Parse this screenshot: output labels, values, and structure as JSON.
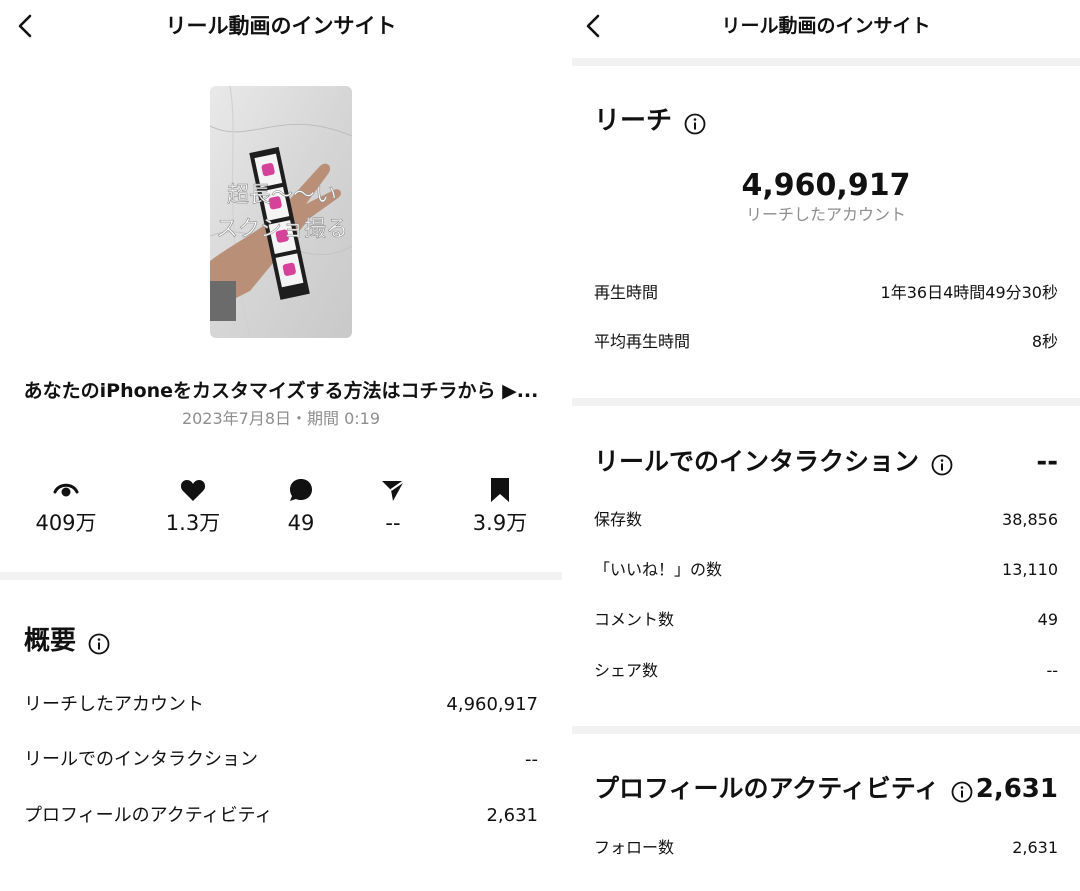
{
  "left": {
    "title": "リール動画のインサイト",
    "thumbnail": {
      "overlay_line1": "超長〜〜い",
      "overlay_line2": "スクショ撮る"
    },
    "caption": "あなたのiPhoneをカスタマイズする方法はコチラから ▶...",
    "date": "2023年7月8日・期間 0:19",
    "stats": [
      {
        "icon": "eye-icon",
        "value": "409万"
      },
      {
        "icon": "heart-icon",
        "value": "1.3万"
      },
      {
        "icon": "comment-icon",
        "value": "49"
      },
      {
        "icon": "share-icon",
        "value": "--"
      },
      {
        "icon": "bookmark-icon",
        "value": "3.9万"
      }
    ],
    "overview": {
      "title": "概要",
      "rows": [
        {
          "label": "リーチしたアカウント",
          "value": "4,960,917"
        },
        {
          "label": "リールでのインタラクション",
          "value": "--"
        },
        {
          "label": "プロフィールのアクティビティ",
          "value": "2,631"
        }
      ]
    }
  },
  "right": {
    "title": "リール動画のインサイト",
    "reach": {
      "title": "リーチ",
      "value": "4,960,917",
      "sublabel": "リーチしたアカウント",
      "rows": [
        {
          "label": "再生時間",
          "value": "1年36日4時間49分30秒"
        },
        {
          "label": "平均再生時間",
          "value": "8秒"
        }
      ]
    },
    "interactions": {
      "title": "リールでのインタラクション",
      "value": "--",
      "rows": [
        {
          "label": "保存数",
          "value": "38,856"
        },
        {
          "label": "「いいね！」の数",
          "value": "13,110"
        },
        {
          "label": "コメント数",
          "value": "49"
        },
        {
          "label": "シェア数",
          "value": "--"
        }
      ]
    },
    "profile_activity": {
      "title": "プロフィールのアクティビティ",
      "value": "2,631",
      "rows": [
        {
          "label": "フォロー数",
          "value": "2,631"
        }
      ]
    }
  }
}
